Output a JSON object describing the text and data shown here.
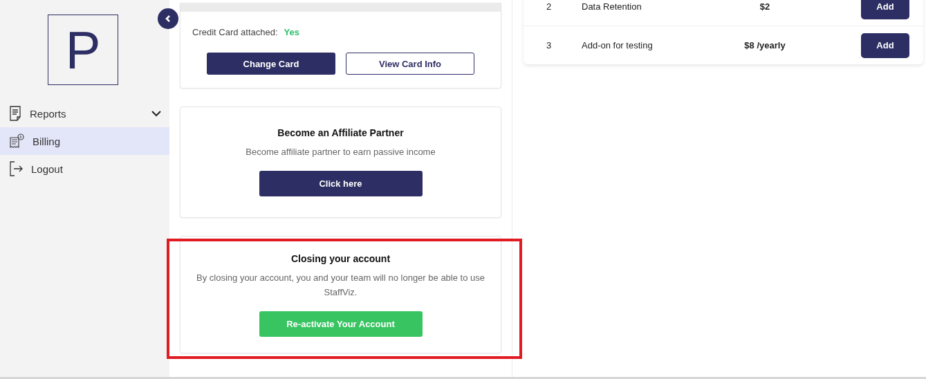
{
  "sidebar": {
    "logo": "P",
    "items": [
      {
        "label": "Reports",
        "kind": "report",
        "expandable": true,
        "selected": false
      },
      {
        "label": "Billing",
        "kind": "billing",
        "expandable": false,
        "selected": true
      },
      {
        "label": "Logout",
        "kind": "logout",
        "expandable": false,
        "selected": false
      }
    ]
  },
  "card_status": {
    "label": "Credit Card attached:",
    "value": "Yes",
    "buttons": [
      {
        "label": "Change Card",
        "kind": "primary"
      },
      {
        "label": "View Card Info",
        "kind": "outline"
      }
    ]
  },
  "affiliate": {
    "title": "Become an Affiliate Partner",
    "text": "Become affiliate partner to earn passive income",
    "button": "Click here"
  },
  "closing": {
    "title": "Closing your account",
    "text": "By closing your account, you and your team will no longer be able to use StaffViz.",
    "button": "Re-activate Your Account"
  },
  "addons": {
    "rows": [
      {
        "number": "2",
        "name": "Data Retention",
        "price": "$2",
        "button": "Add"
      },
      {
        "number": "3",
        "name": "Add-on for testing",
        "price": "$8 /yearly",
        "button": "Add"
      }
    ]
  }
}
